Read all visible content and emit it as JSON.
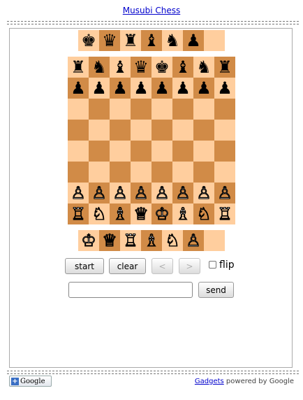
{
  "app_title": "Musubi Chess",
  "captured_top": [
    "♚",
    "♛",
    "♜",
    "♝",
    "♞",
    "♟",
    ""
  ],
  "captured_bottom": [
    "♔",
    "♕",
    "♖",
    "♗",
    "♘",
    "♙",
    ""
  ],
  "board": [
    [
      "♜",
      "♞",
      "♝",
      "♛",
      "♚",
      "♝",
      "♞",
      "♜"
    ],
    [
      "♟",
      "♟",
      "♟",
      "♟",
      "♟",
      "♟",
      "♟",
      "♟"
    ],
    [
      "",
      "",
      "",
      "",
      "",
      "",
      "",
      ""
    ],
    [
      "",
      "",
      "",
      "",
      "",
      "",
      "",
      ""
    ],
    [
      "",
      "",
      "",
      "",
      "",
      "",
      "",
      ""
    ],
    [
      "",
      "",
      "",
      "",
      "",
      "",
      "",
      ""
    ],
    [
      "♙",
      "♙",
      "♙",
      "♙",
      "♙",
      "♙",
      "♙",
      "♙"
    ],
    [
      "♖",
      "♘",
      "♗",
      "♕",
      "♔",
      "♗",
      "♘",
      "♖"
    ]
  ],
  "controls": {
    "start": "start",
    "clear": "clear",
    "prev": "<",
    "next": ">",
    "flip": "flip",
    "send": "send",
    "message_value": ""
  },
  "footer": {
    "google_button": "Google",
    "gadgets_link": "Gadgets",
    "powered_by": "powered by Google"
  },
  "colors": {
    "light_square": "#ffce9e",
    "dark_square": "#d18b47"
  }
}
